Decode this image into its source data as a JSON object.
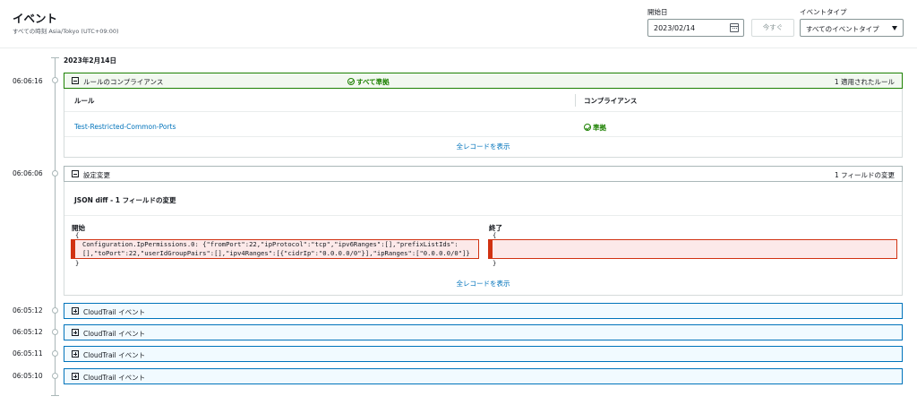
{
  "page": {
    "title": "イベント",
    "subtitle": "すべての時刻 Asia/Tokyo (UTC+09:00)"
  },
  "controls": {
    "start_date_label": "開始日",
    "start_date_value": "2023/02/14",
    "now_button": "今すぐ",
    "event_type_label": "イベントタイプ",
    "event_type_value": "すべてのイベントタイプ"
  },
  "timeline": {
    "date_heading": "2023年2月14日"
  },
  "compliance_event": {
    "time": "06:06:16",
    "title": "ルールのコンプライアンス",
    "status": "すべて準拠",
    "summary": "1 適用されたルール",
    "columns": [
      "ルール",
      "コンプライアンス"
    ],
    "rows": [
      {
        "rule": "Test-Restricted-Common-Ports",
        "compliance": "準拠"
      }
    ],
    "view_all": "全レコードを表示"
  },
  "config_event": {
    "time": "06:06:06",
    "title": "設定変更",
    "summary": "1 フィールドの変更",
    "diff_heading": "JSON diff - 1 フィールドの変更",
    "before_label": "開始",
    "after_label": "終了",
    "before_open": "{",
    "before_line1": "Configuration.IpPermissions.0: {\"fromPort\":22,\"ipProtocol\":\"tcp\",\"ipv6Ranges\":[],\"prefixListIds\":",
    "before_line2": "[],\"toPort\":22,\"userIdGroupPairs\":[],\"ipv4Ranges\":[{\"cidrIp\":\"0.0.0.0/0\"}],\"ipRanges\":[\"0.0.0.0/0\"]}",
    "before_close": "}",
    "after_open": "{",
    "after_close": "}",
    "view_all": "全レコードを表示"
  },
  "cloudtrail_events": [
    {
      "time": "06:05:12",
      "title": "CloudTrail イベント"
    },
    {
      "time": "06:05:12",
      "title": "CloudTrail イベント"
    },
    {
      "time": "06:05:11",
      "title": "CloudTrail イベント"
    },
    {
      "time": "06:05:10",
      "title": "CloudTrail イベント"
    }
  ]
}
